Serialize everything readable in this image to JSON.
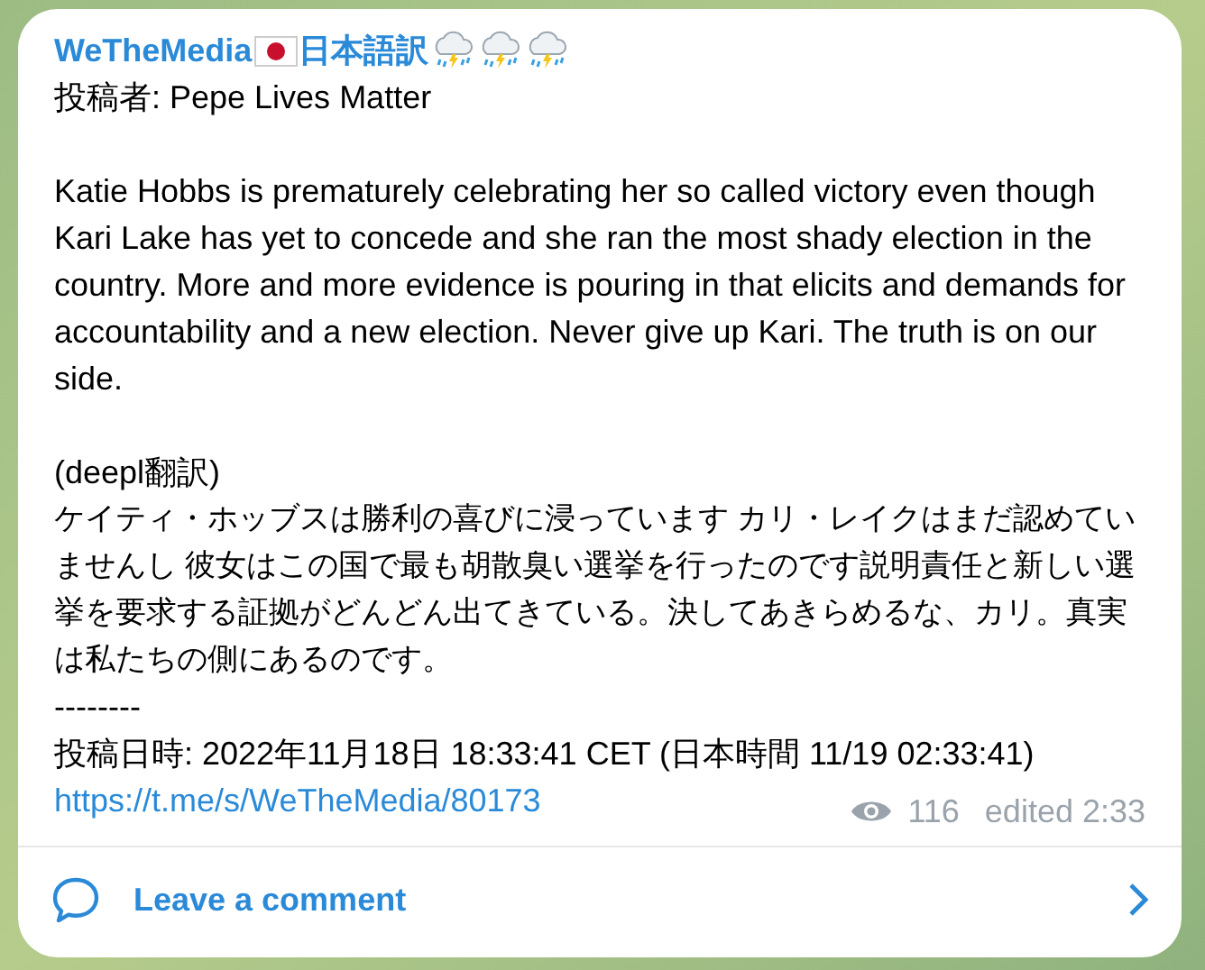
{
  "channel": {
    "name": "WeTheMedia",
    "suffix": "日本語訳"
  },
  "author_line": "投稿者: Pepe Lives Matter",
  "body": "Katie Hobbs is prematurely celebrating her so called victory even though Kari Lake has yet to concede and she ran the most shady election in the country. More and more evidence is pouring in that elicits and demands for accountability and a new election. Never give up Kari. The truth is on our side.",
  "translation_label": "(deepl翻訳)",
  "translation": "ケイティ・ホッブスは勝利の喜びに浸っています カリ・レイクはまだ認めていませんし 彼女はこの国で最も胡散臭い選挙を行ったのです説明責任と新しい選挙を要求する証拠がどんどん出てきている。決してあきらめるな、カリ。真実は私たちの側にあるのです。",
  "separator": "--------",
  "posted_line": "投稿日時: 2022年11月18日 18:33:41 CET (日本時間 11/19 02:33:41)",
  "link": "https://t.me/s/WeTheMedia/80173",
  "views": "116",
  "edited": "edited 2:33",
  "comment_button": "Leave a comment"
}
